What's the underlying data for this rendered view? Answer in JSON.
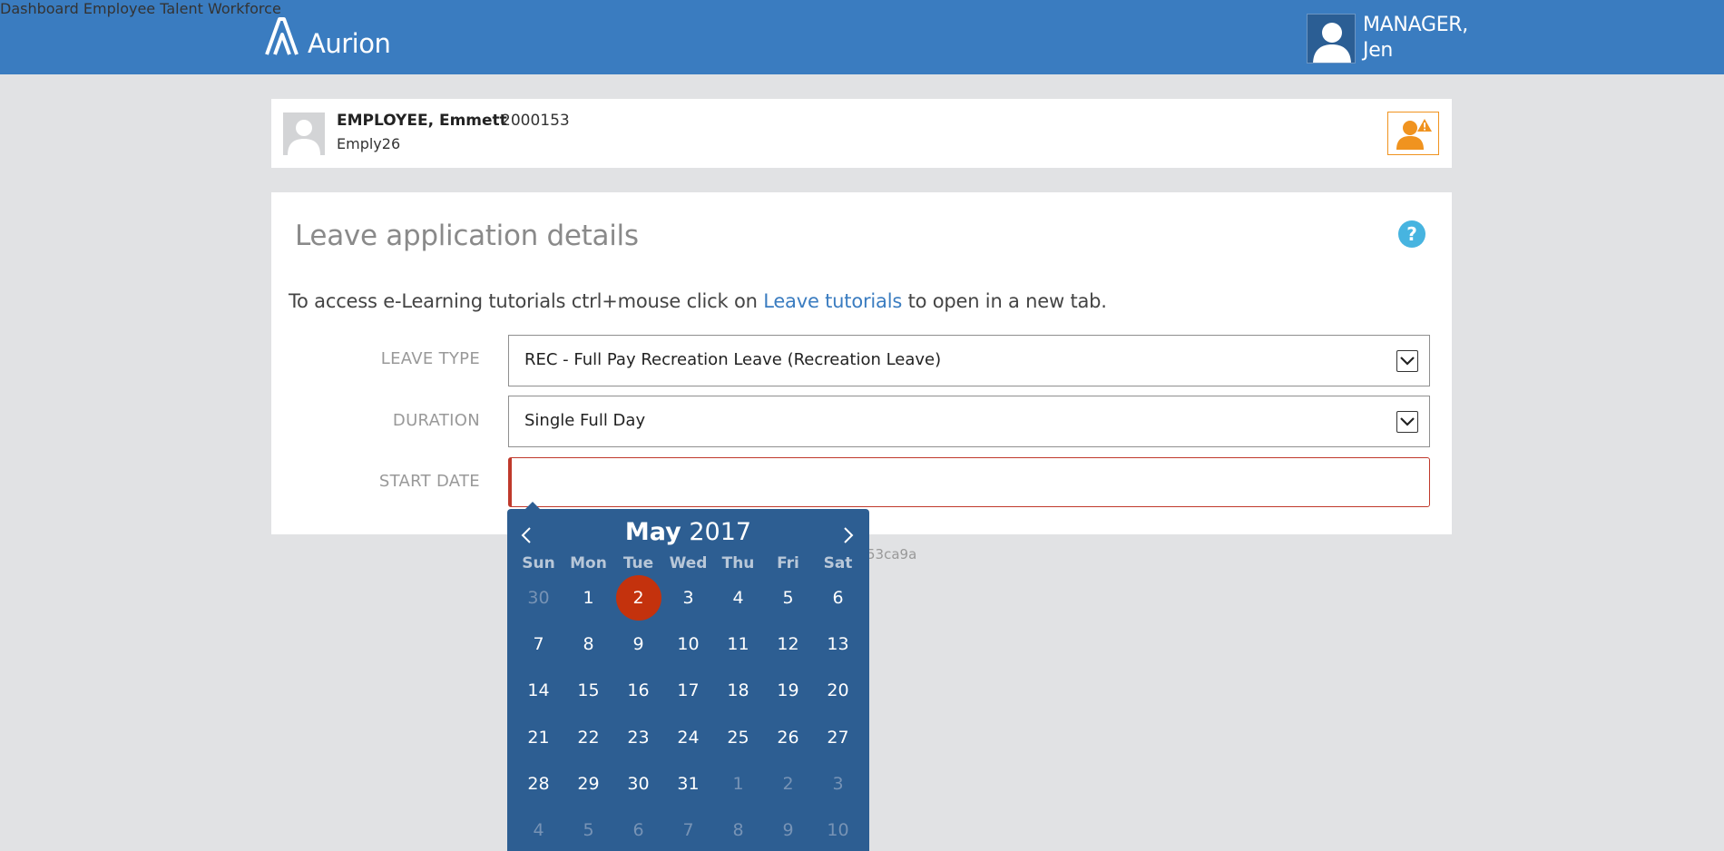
{
  "app": {
    "brand": "Aurion",
    "nav": [
      "Dashboard",
      "Employee",
      "Talent",
      "Workforce"
    ],
    "user_line1": "MANAGER,",
    "user_line2": "Jen"
  },
  "employee": {
    "name": "EMPLOYEE, Emmett",
    "id": "2000153",
    "username": "Emply26"
  },
  "form": {
    "title": "Leave application details",
    "help_label": "?",
    "intro_before": "To access e-Learning tutorials ctrl+mouse click on ",
    "intro_link": "Leave tutorials",
    "intro_after": " to open in a new tab.",
    "leave_type_label": "LEAVE TYPE",
    "leave_type_value": "REC - Full Pay Recreation Leave (Recreation Leave)",
    "duration_label": "DURATION",
    "duration_value": "Single Full Day",
    "start_date_label": "START DATE",
    "start_date_value": ""
  },
  "faint_text": "53ca9a",
  "calendar": {
    "month": "May",
    "year": "2017",
    "weekdays": [
      "Sun",
      "Mon",
      "Tue",
      "Wed",
      "Thu",
      "Fri",
      "Sat"
    ],
    "selected_day": 2,
    "weeks": [
      [
        {
          "d": "30",
          "m": true
        },
        {
          "d": "1"
        },
        {
          "d": "2",
          "sel": true
        },
        {
          "d": "3"
        },
        {
          "d": "4"
        },
        {
          "d": "5"
        },
        {
          "d": "6"
        }
      ],
      [
        {
          "d": "7"
        },
        {
          "d": "8"
        },
        {
          "d": "9"
        },
        {
          "d": "10"
        },
        {
          "d": "11"
        },
        {
          "d": "12"
        },
        {
          "d": "13"
        }
      ],
      [
        {
          "d": "14"
        },
        {
          "d": "15"
        },
        {
          "d": "16"
        },
        {
          "d": "17"
        },
        {
          "d": "18"
        },
        {
          "d": "19"
        },
        {
          "d": "20"
        }
      ],
      [
        {
          "d": "21"
        },
        {
          "d": "22"
        },
        {
          "d": "23"
        },
        {
          "d": "24"
        },
        {
          "d": "25"
        },
        {
          "d": "26"
        },
        {
          "d": "27"
        }
      ],
      [
        {
          "d": "28"
        },
        {
          "d": "29"
        },
        {
          "d": "30"
        },
        {
          "d": "31"
        },
        {
          "d": "1",
          "m": true
        },
        {
          "d": "2",
          "m": true
        },
        {
          "d": "3",
          "m": true
        }
      ],
      [
        {
          "d": "4",
          "m": true
        },
        {
          "d": "5",
          "m": true
        },
        {
          "d": "6",
          "m": true
        },
        {
          "d": "7",
          "m": true
        },
        {
          "d": "8",
          "m": true
        },
        {
          "d": "9",
          "m": true
        },
        {
          "d": "10",
          "m": true
        }
      ]
    ]
  },
  "colors": {
    "header": "#3a7cc0",
    "calendar": "#2d5e92",
    "selected": "#c4320d",
    "error": "#c0392b",
    "alert": "#f0931f",
    "help": "#47b4e0"
  }
}
